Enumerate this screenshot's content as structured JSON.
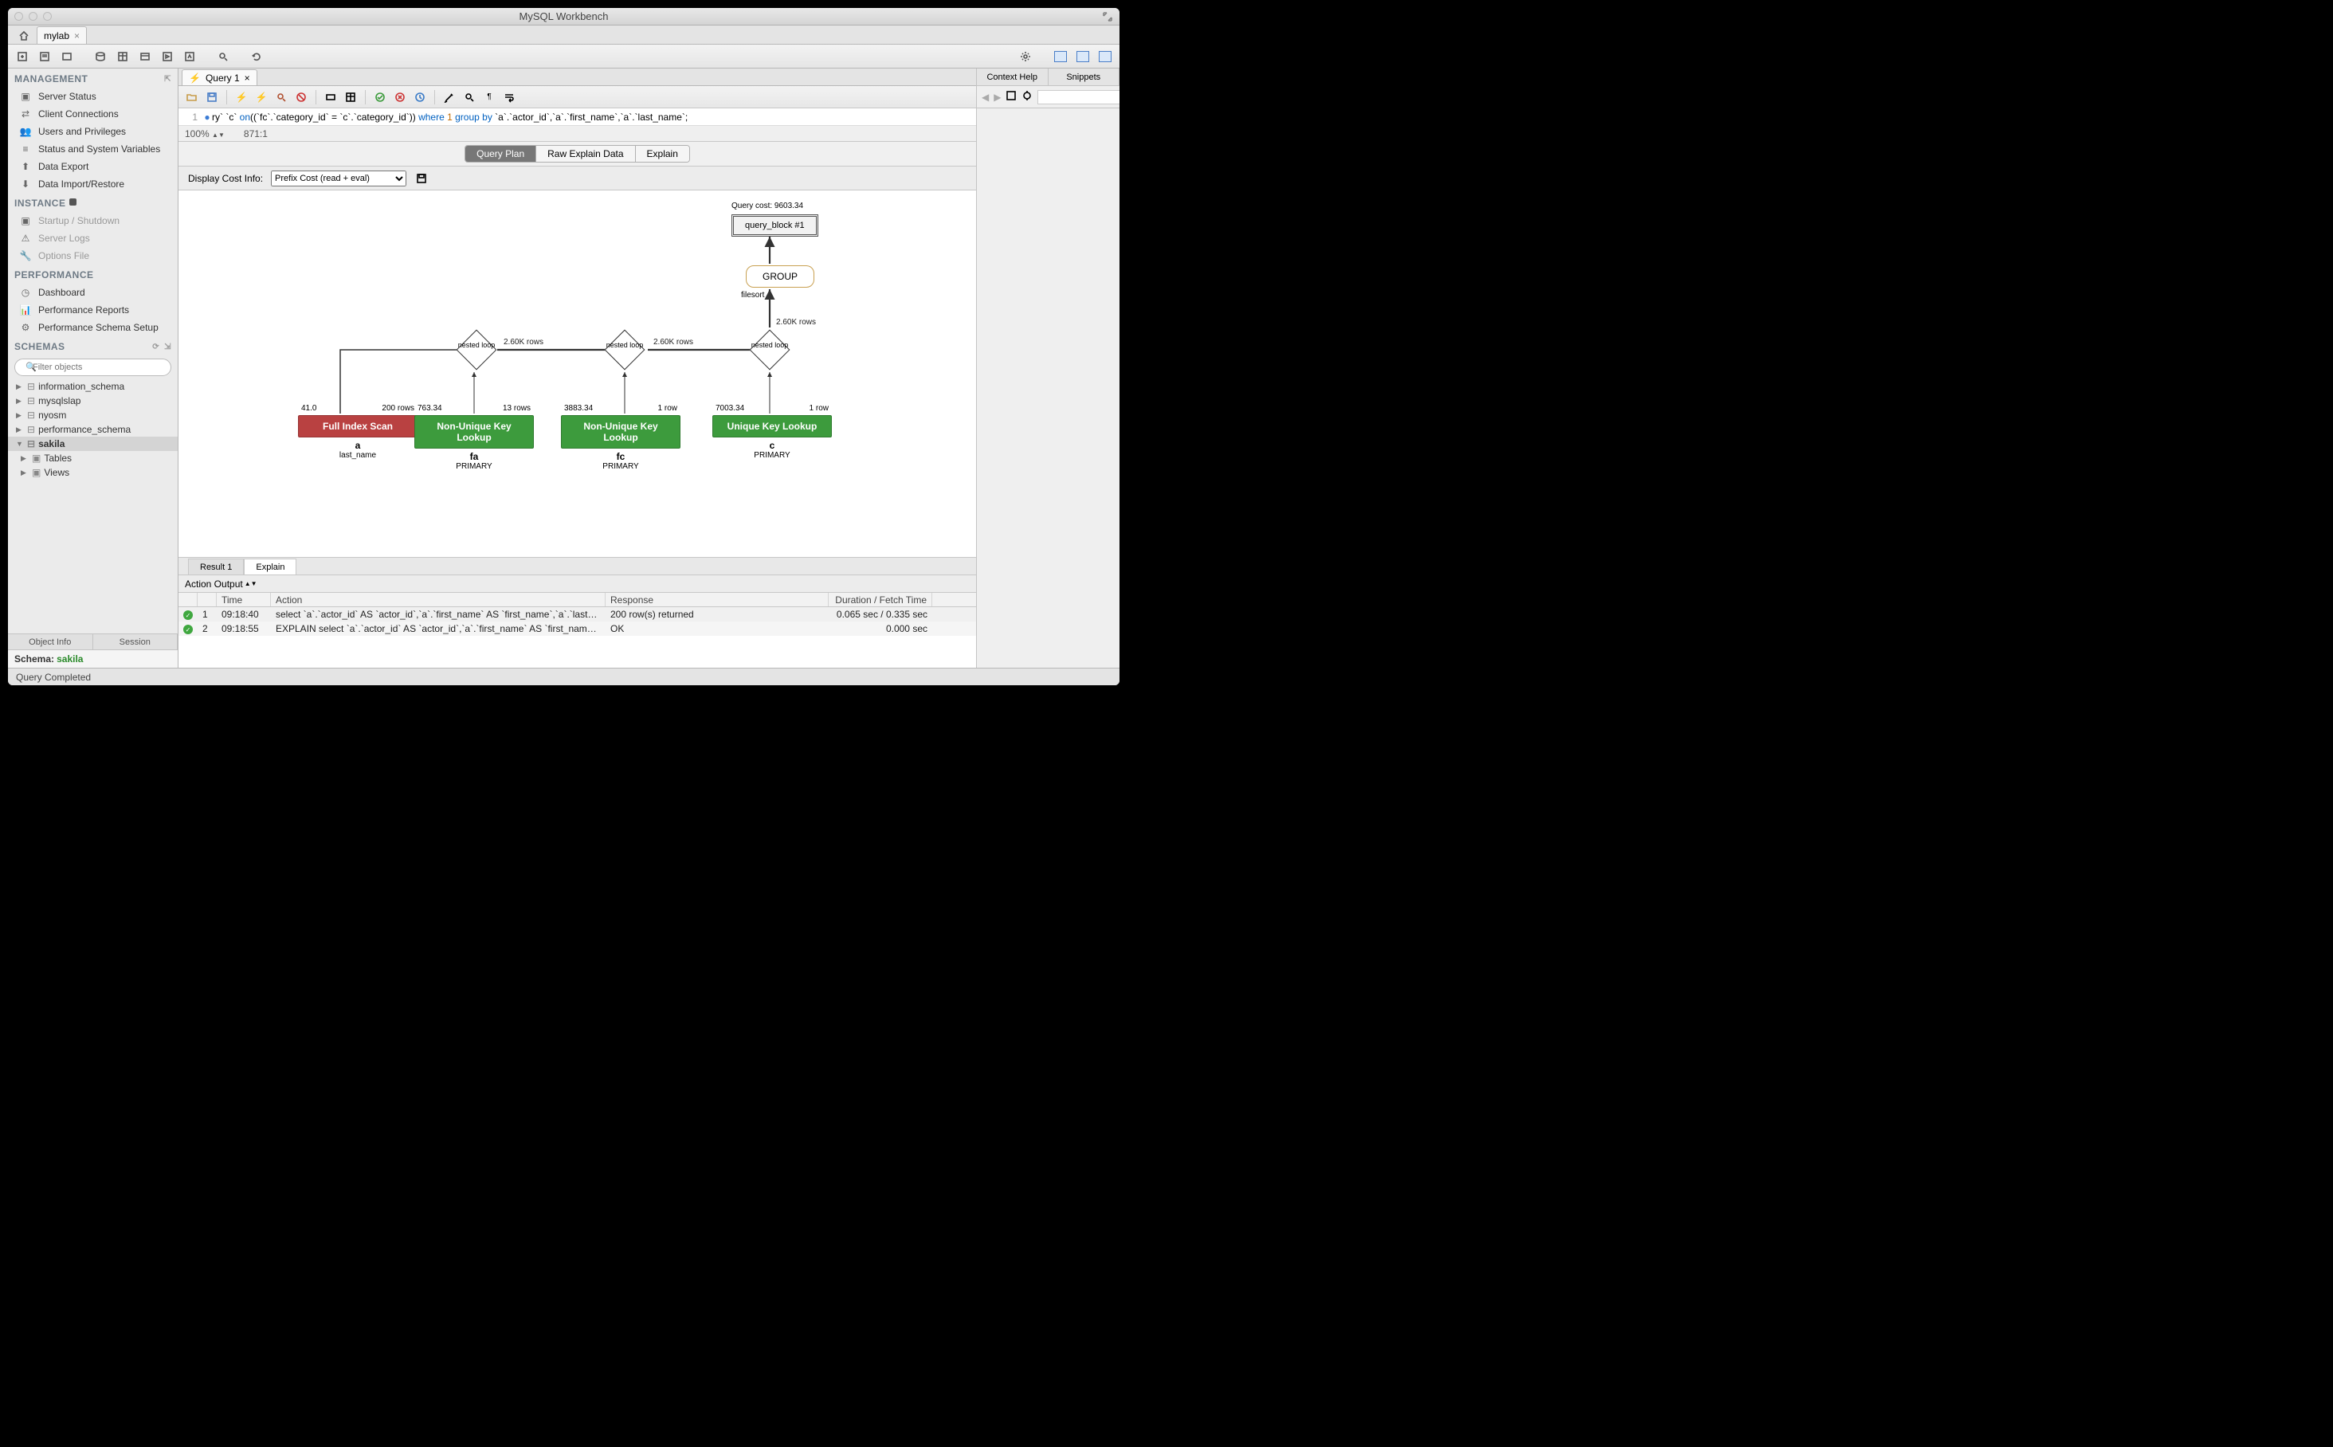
{
  "window_title": "MySQL Workbench",
  "connection_tab": "mylab",
  "sidebar": {
    "management_h": "MANAGEMENT",
    "management": [
      "Server Status",
      "Client Connections",
      "Users and Privileges",
      "Status and System Variables",
      "Data Export",
      "Data Import/Restore"
    ],
    "instance_h": "INSTANCE",
    "instance": [
      "Startup / Shutdown",
      "Server Logs",
      "Options File"
    ],
    "performance_h": "PERFORMANCE",
    "performance": [
      "Dashboard",
      "Performance Reports",
      "Performance Schema Setup"
    ],
    "schemas_h": "SCHEMAS",
    "filter_placeholder": "Filter objects",
    "schemas": [
      "information_schema",
      "mysqlslap",
      "nyosm",
      "performance_schema",
      "sakila"
    ],
    "sakila_children": [
      "Tables",
      "Views"
    ],
    "side_tabs": [
      "Object Info",
      "Session"
    ],
    "schema_label": "Schema:",
    "schema_value": "sakila"
  },
  "query_tab_label": "Query 1",
  "editor": {
    "line_no": "1",
    "segments": [
      {
        "t": "ry` `c` ",
        "c": ""
      },
      {
        "t": "on",
        "c": "kw"
      },
      {
        "t": "((`fc`.`category_id` = `c`.`category_id`)) ",
        "c": ""
      },
      {
        "t": "where",
        "c": "kw"
      },
      {
        "t": " ",
        "c": ""
      },
      {
        "t": "1",
        "c": "lit"
      },
      {
        "t": " ",
        "c": ""
      },
      {
        "t": "group by",
        "c": "kw"
      },
      {
        "t": " `a`.`actor_id`,`a`.`first_name`,`a`.`last_name`;",
        "c": ""
      }
    ],
    "zoom": "100%",
    "cursor": "871:1"
  },
  "plan_tabs": [
    "Query Plan",
    "Raw Explain Data",
    "Explain"
  ],
  "cost_label": "Display Cost Info:",
  "cost_select": "Prefix Cost (read + eval)",
  "diagram": {
    "query_cost": "Query cost: 9603.34",
    "query_block": "query_block #1",
    "group": "GROUP",
    "filesort": "filesort",
    "loop": "nested\nloop",
    "edge_260k": "2.60K rows",
    "nodes": [
      {
        "op": "Full Index Scan",
        "color": "red",
        "t1": "a",
        "t2": "last_name",
        "cl": "41.0",
        "cr": "200 rows"
      },
      {
        "op": "Non-Unique Key Lookup",
        "color": "green",
        "t1": "fa",
        "t2": "PRIMARY",
        "cl": "763.34",
        "cr": "13 rows"
      },
      {
        "op": "Non-Unique Key Lookup",
        "color": "green",
        "t1": "fc",
        "t2": "PRIMARY",
        "cl": "3883.34",
        "cr": "1 row"
      },
      {
        "op": "Unique Key Lookup",
        "color": "green",
        "t1": "c",
        "t2": "PRIMARY",
        "cl": "7003.34",
        "cr": "1 row"
      }
    ]
  },
  "result_tabs": [
    "Result 1",
    "Explain"
  ],
  "output_label": "Action Output",
  "grid_headers": {
    "time": "Time",
    "action": "Action",
    "response": "Response",
    "duration": "Duration / Fetch Time"
  },
  "grid_rows": [
    {
      "idx": "1",
      "time": "09:18:40",
      "action": "select `a`.`actor_id` AS `actor_id`,`a`.`first_name` AS `first_name`,`a`.`last_...",
      "response": "200 row(s) returned",
      "duration": "0.065 sec / 0.335 sec"
    },
    {
      "idx": "2",
      "time": "09:18:55",
      "action": "EXPLAIN select `a`.`actor_id` AS `actor_id`,`a`.`first_name` AS `first_name`,`...",
      "response": "OK",
      "duration": "0.000 sec"
    }
  ],
  "status": "Query Completed",
  "right_tabs": [
    "Context Help",
    "Snippets"
  ]
}
